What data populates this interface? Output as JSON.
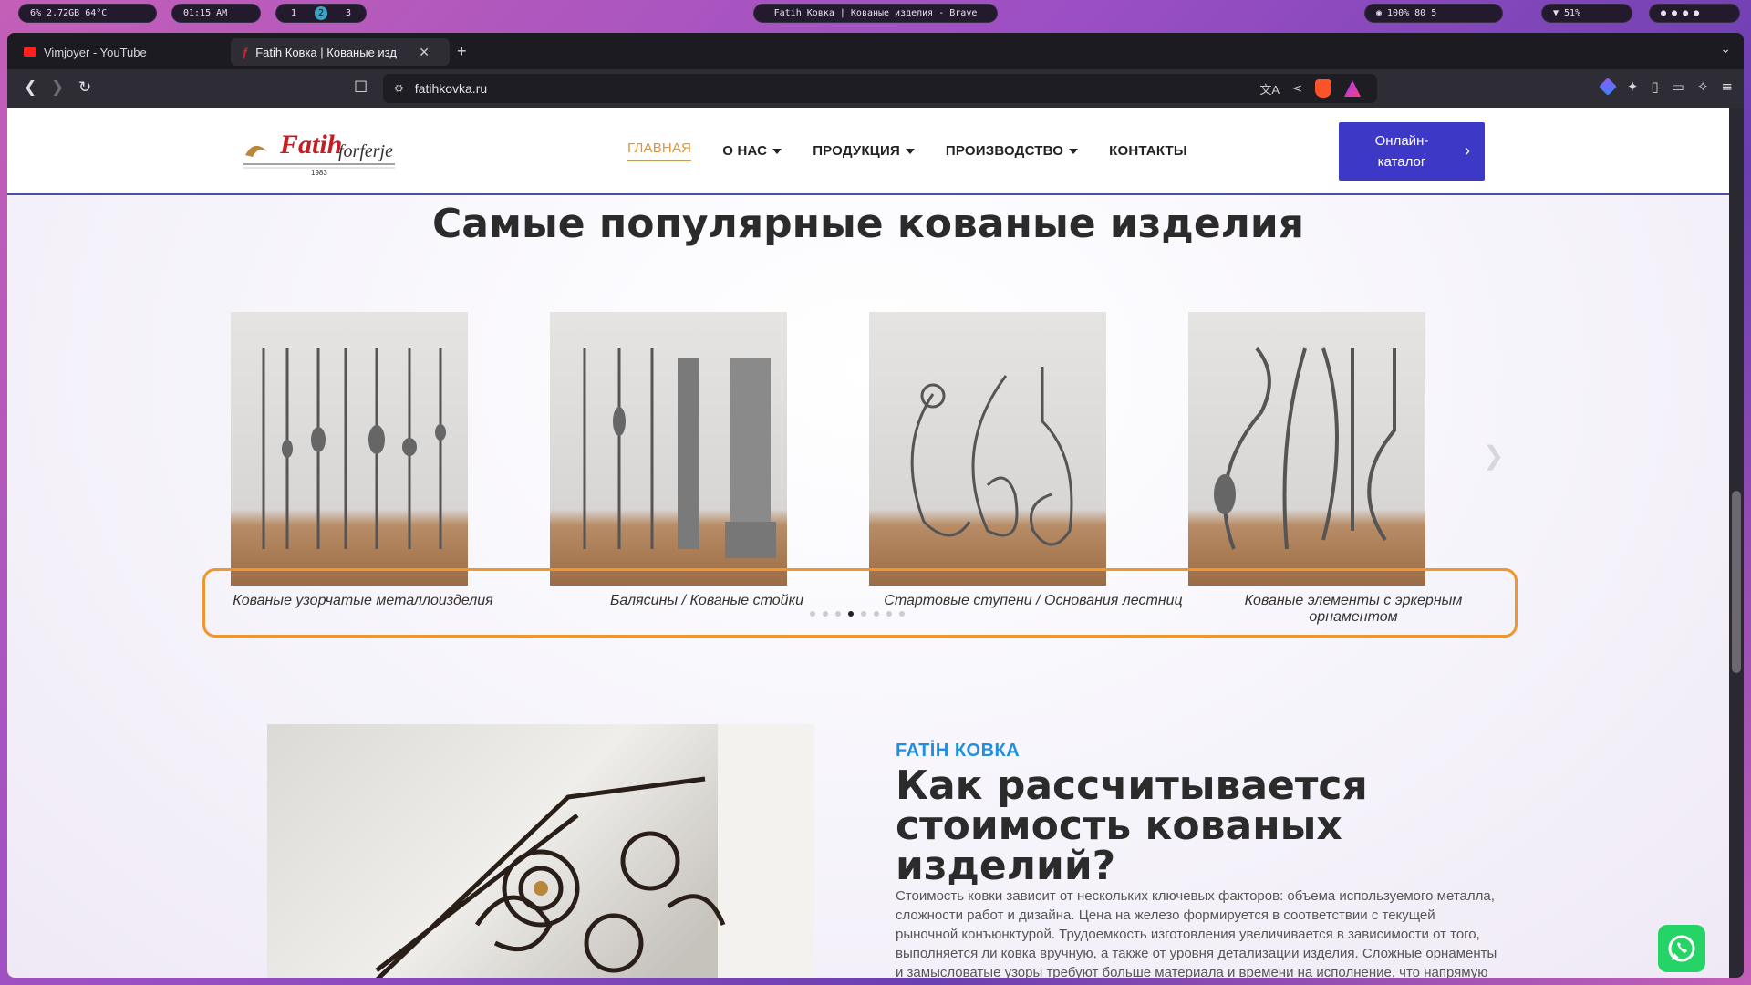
{
  "system_bar": {
    "left_stats": "6%  2.72GB  64°C",
    "time": "01:15 AM",
    "workspaces": [
      "1",
      "2",
      "3"
    ],
    "active_workspace": "2",
    "window_title": "Fatih Ковка | Кованые изделия - Brave",
    "right_stats": "100%   80   5",
    "battery": "51%"
  },
  "browser": {
    "tabs": [
      {
        "label": "Vimjoyer - YouTube",
        "favicon": "youtube-icon"
      },
      {
        "label": "Fatih Ковка | Кованые изд",
        "favicon": "fatih-icon",
        "active": true
      }
    ],
    "url": "fatihkovka.ru",
    "shields_badge": "1",
    "rewards_badge": "1"
  },
  "site": {
    "nav": [
      {
        "label": "ГЛАВНАЯ",
        "current": true
      },
      {
        "label": "О НАС",
        "dropdown": true
      },
      {
        "label": "ПРОДУКЦИЯ",
        "dropdown": true
      },
      {
        "label": "ПРОИЗВОДСТВО",
        "dropdown": true
      },
      {
        "label": "КОНТАКТЫ"
      }
    ],
    "catalog_button": "Онлайн-каталог",
    "logo_text": "Fatih",
    "logo_sub": "forferje",
    "logo_year": "1983"
  },
  "popular": {
    "title": "Самые популярные кованые изделия",
    "items": [
      {
        "caption": "Кованые узорчатые металлоизделия"
      },
      {
        "caption": "Балясины / Кованые стойки"
      },
      {
        "caption": "Стартовые ступени / Основания лестниц"
      },
      {
        "caption": "Кованые элементы с эркерным орнаментом"
      }
    ],
    "dots_total": 8,
    "dots_active": 3
  },
  "pricing": {
    "eyebrow": "FATİH КОВКА",
    "heading": "Как рассчитывается стоимость кованых изделий?",
    "body": "Стоимость ковки зависит от нескольких ключевых факторов: объема используемого металла, сложности работ и дизайна. Цена на железо формируется в соответствии с текущей рыночной конъюнктурой. Трудоемкость изготовления увеличивается в зависимости от того, выполняется ли ковка вручную, а также от уровня детализации изделия. Сложные орнаменты и замысловатые узоры требуют больше материала и времени на исполнение, что напрямую"
  },
  "colors": {
    "accent": "#e0952f",
    "button": "#3e38c6",
    "eyebrow": "#1f8fe0",
    "highlight": "#f0962f"
  }
}
